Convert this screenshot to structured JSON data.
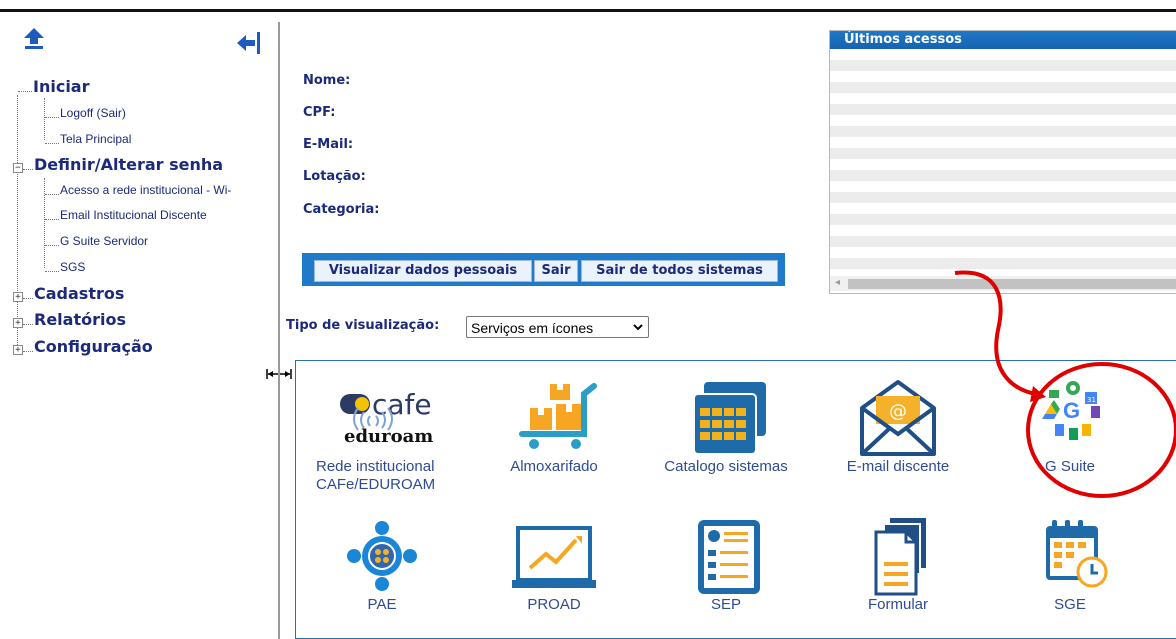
{
  "sidebar": {
    "tree": {
      "iniciar": "Iniciar",
      "logoff": "Logoff (Sair)",
      "tela_principal": "Tela Principal",
      "definir_senha": "Definir/Alterar senha",
      "acesso_rede": "Acesso a rede institucional - Wi-",
      "email_discente": "Email Institucional Discente",
      "gsuite_servidor": "G Suite Servidor",
      "sgs": "SGS",
      "cadastros": "Cadastros",
      "relatorios": "Relatórios",
      "configuracao": "Configuração"
    },
    "expanded_symbol": "−",
    "collapsed_symbol": "+"
  },
  "profile": {
    "nome_label": "Nome:",
    "cpf_label": "CPF:",
    "email_label": "E-Mail:",
    "lotacao_label": "Lotação:",
    "categoria_label": "Categoria:"
  },
  "actions": {
    "visualizar": "Visualizar dados pessoais",
    "sair": "Sair",
    "sair_todos": "Sair de todos sistemas"
  },
  "view_selector": {
    "label": "Tipo de visualização:",
    "selected": "Serviços em ícones"
  },
  "recent_access": {
    "title": "Últimos acessos"
  },
  "services": [
    {
      "label": "Rede institucional CAFe/EDUROAM",
      "logo_text_1": "cafe",
      "logo_text_2": "eduroam"
    },
    {
      "label": "Almoxarifado"
    },
    {
      "label": "Catalogo sistemas"
    },
    {
      "label": "E-mail discente",
      "logo_text": "@"
    },
    {
      "label": "G Suite",
      "logo_text": "G",
      "calendar_text": "31"
    },
    {
      "label": "PAE"
    },
    {
      "label": "PROAD"
    },
    {
      "label": "SEP"
    },
    {
      "label": "Formular"
    },
    {
      "label": "SGE"
    }
  ],
  "colors": {
    "link": "#1b2a7a",
    "header_blue": "#1e78c8",
    "annotation_red": "#e00000"
  }
}
